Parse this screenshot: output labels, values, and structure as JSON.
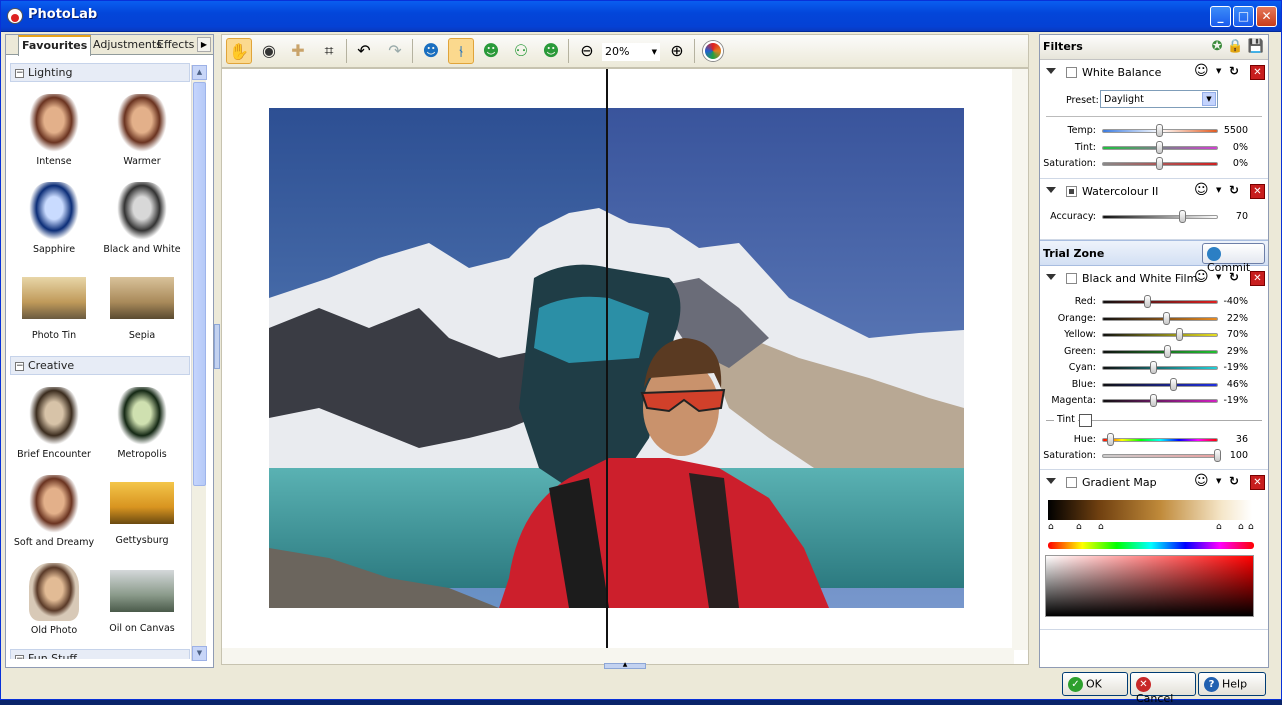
{
  "app": {
    "title": "PhotoLab"
  },
  "window_controls": {
    "minimize": "_",
    "maximize": "□",
    "close": "✕"
  },
  "left_panel": {
    "tabs": [
      {
        "label": "Favourites",
        "active": true
      },
      {
        "label": "Adjustments",
        "active": false
      },
      {
        "label": "Effects",
        "active": false
      }
    ],
    "sections": [
      {
        "title": "Lighting",
        "items": [
          {
            "label": "Intense",
            "icon": "portrait-warm"
          },
          {
            "label": "Warmer",
            "icon": "portrait-warm"
          },
          {
            "label": "Sapphire",
            "icon": "portrait-blue"
          },
          {
            "label": "Black and White",
            "icon": "portrait-bw"
          },
          {
            "label": "Photo Tin",
            "icon": "landscape-tin"
          },
          {
            "label": "Sepia",
            "icon": "landscape-sepia"
          }
        ]
      },
      {
        "title": "Creative",
        "items": [
          {
            "label": "Brief Encounter",
            "icon": "portrait-faded"
          },
          {
            "label": "Metropolis",
            "icon": "portrait-green"
          },
          {
            "label": "Soft and Dreamy",
            "icon": "portrait-warm"
          },
          {
            "label": "Gettysburg",
            "icon": "landscape-gold"
          },
          {
            "label": "Old Photo",
            "icon": "portrait-old"
          },
          {
            "label": "Oil on Canvas",
            "icon": "landscape-canvas"
          }
        ]
      },
      {
        "title": "Fun Stuff",
        "items": []
      }
    ]
  },
  "toolbar": {
    "zoom_value": "20%",
    "tools": [
      "hand-icon",
      "red-eye-icon",
      "healing-icon",
      "crop-icon",
      "undo-icon",
      "redo-icon",
      "person-icon",
      "split-vertical-icon",
      "split-horizontal-icon",
      "split-side-icon",
      "split-stack-icon",
      "zoom-out-icon",
      "zoom-in-icon",
      "color-wheel-icon"
    ]
  },
  "filters_panel": {
    "title": "Filters",
    "filters": [
      {
        "name": "White Balance",
        "enabled": false,
        "preset_label": "Preset:",
        "preset_value": "Daylight",
        "sliders": [
          {
            "label": "Temp:",
            "value": "5500",
            "fraction": 0.5,
            "track": "temp"
          },
          {
            "label": "Tint:",
            "value": "0%",
            "fraction": 0.5,
            "track": "tint"
          },
          {
            "label": "Saturation:",
            "value": "0%",
            "fraction": 0.5,
            "track": "sat"
          }
        ]
      },
      {
        "name": "Watercolour II",
        "enabled": true,
        "sliders": [
          {
            "label": "Accuracy:",
            "value": "70",
            "fraction": 0.7,
            "track": "gray"
          }
        ]
      }
    ],
    "trial_zone": {
      "title": "Trial Zone",
      "commit_label": "Commit",
      "filters": [
        {
          "name": "Black and White Film",
          "enabled": false,
          "sliders": [
            {
              "label": "Red:",
              "value": "-40%",
              "fraction": 0.4,
              "track": "red"
            },
            {
              "label": "Orange:",
              "value": "22%",
              "fraction": 0.56,
              "track": "orange"
            },
            {
              "label": "Yellow:",
              "value": "70%",
              "fraction": 0.67,
              "track": "yellow"
            },
            {
              "label": "Green:",
              "value": "29%",
              "fraction": 0.57,
              "track": "green"
            },
            {
              "label": "Cyan:",
              "value": "-19%",
              "fraction": 0.45,
              "track": "cyan"
            },
            {
              "label": "Blue:",
              "value": "46%",
              "fraction": 0.62,
              "track": "blue"
            },
            {
              "label": "Magenta:",
              "value": "-19%",
              "fraction": 0.45,
              "track": "magenta"
            }
          ],
          "tint_label": "Tint",
          "sliders2": [
            {
              "label": "Hue:",
              "value": "36",
              "fraction": 0.08,
              "track": "hue"
            },
            {
              "label": "Saturation:",
              "value": "100",
              "fraction": 1.0,
              "track": "sat2"
            }
          ]
        },
        {
          "name": "Gradient Map",
          "enabled": false
        }
      ]
    }
  },
  "buttons": {
    "ok": "OK",
    "cancel": "Cancel",
    "help": "Help"
  }
}
